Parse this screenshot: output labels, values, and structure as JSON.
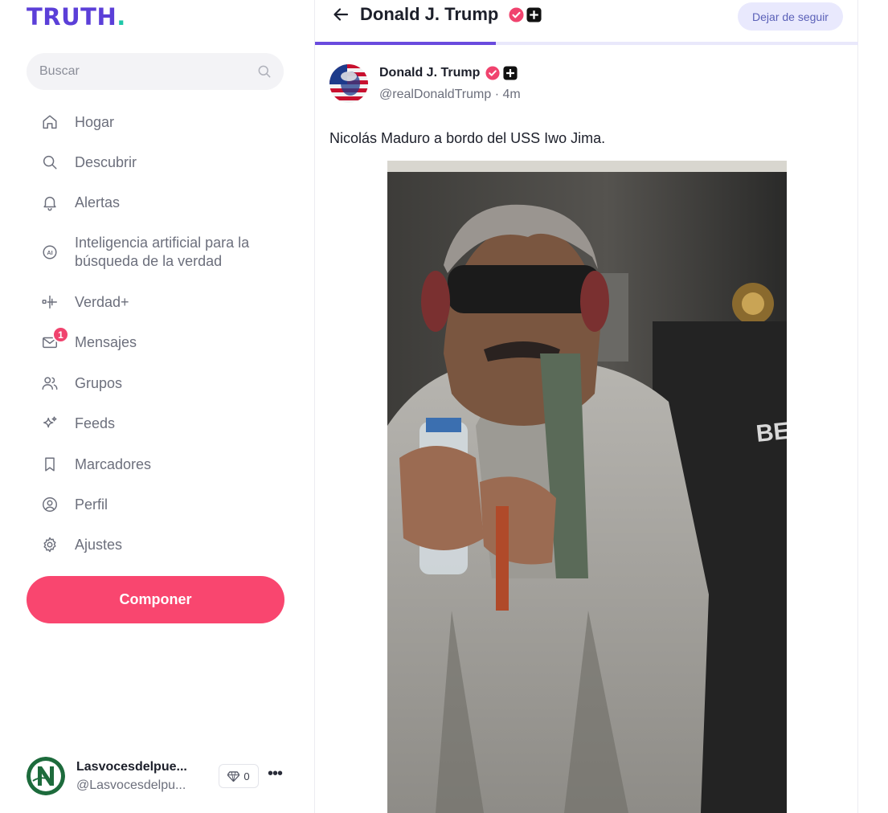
{
  "app": {
    "logo_text": "TRUTH",
    "logo_dot": ".",
    "brand_color": "#5b3fd8",
    "accent_color": "#f9466f"
  },
  "search": {
    "placeholder": "Buscar",
    "icon": "search-icon"
  },
  "sidebar": {
    "items": [
      {
        "label": "Hogar",
        "icon": "home-icon"
      },
      {
        "label": "Descubrir",
        "icon": "search-icon"
      },
      {
        "label": "Alertas",
        "icon": "bell-icon"
      },
      {
        "label_line1": "Inteligencia artificial para la",
        "label_line2": "búsqueda de la verdad",
        "icon": "ai-icon"
      },
      {
        "label": "Verdad+",
        "icon": "truth-plus-icon"
      },
      {
        "label": "Mensajes",
        "icon": "mail-icon",
        "badge": "1"
      },
      {
        "label": "Grupos",
        "icon": "users-icon"
      },
      {
        "label": "Feeds",
        "icon": "sparkles-icon"
      },
      {
        "label": "Marcadores",
        "icon": "bookmark-icon"
      },
      {
        "label": "Perfil",
        "icon": "user-circle-icon"
      },
      {
        "label": "Ajustes",
        "icon": "gear-icon"
      }
    ],
    "compose_label": "Componer"
  },
  "account": {
    "name": "Lasvocesdelpue...",
    "handle": "@Lasvocesdelpu...",
    "gems": "0",
    "more_icon": "more-icon"
  },
  "header": {
    "title": "Donald J. Trump",
    "unfollow_label": "Dejar de seguir"
  },
  "post": {
    "author": "Donald J. Trump",
    "handle": "@realDonaldTrump",
    "separator": "·",
    "time": "4m",
    "text": "Nicolás Maduro a bordo del USS Iwo Jima."
  }
}
